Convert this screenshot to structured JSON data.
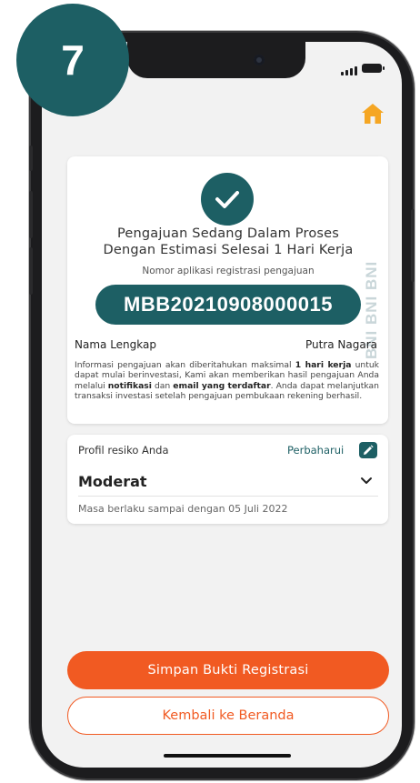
{
  "step": {
    "number": "7"
  },
  "status": {
    "title_line1": "Pengajuan Sedang Dalam Proses",
    "title_line2": "Dengan Estimasi Selesai 1 Hari Kerja",
    "registration_label": "Nomor aplikasi registrasi pengajuan",
    "registration_number": "MBB20210908000015",
    "watermark": "BNI BNI BNI"
  },
  "applicant": {
    "name_label": "Nama Lengkap",
    "name_value": "Putra Nagara"
  },
  "info": {
    "part1": "Informasi pengajuan akan diberitahukan maksimal ",
    "bold1": "1 hari kerja",
    "part2": " untuk dapat mulai berinvestasi, Kami akan memberikan hasil pengajuan Anda melalui ",
    "bold2": "notifikasi",
    "part3": " dan ",
    "bold3": "email yang terdaftar",
    "part4": ". Anda dapat melanjutkan transaksi investasi setelah pengajuan pembukaan rekening berhasil."
  },
  "risk_profile": {
    "label": "Profil resiko Anda",
    "update_link": "Perbaharui",
    "value": "Moderat",
    "validity": "Masa berlaku sampai dengan 05 Juli 2022"
  },
  "actions": {
    "save_label": "Simpan Bukti Registrasi",
    "home_label": "Kembali ke Beranda"
  },
  "colors": {
    "primary_teal": "#1d5f64",
    "accent_orange": "#f15a22",
    "home_icon": "#f5a623"
  },
  "icons": {
    "home": "home-icon",
    "check": "check-icon",
    "edit": "pencil-icon",
    "chevron": "chevron-down-icon"
  }
}
